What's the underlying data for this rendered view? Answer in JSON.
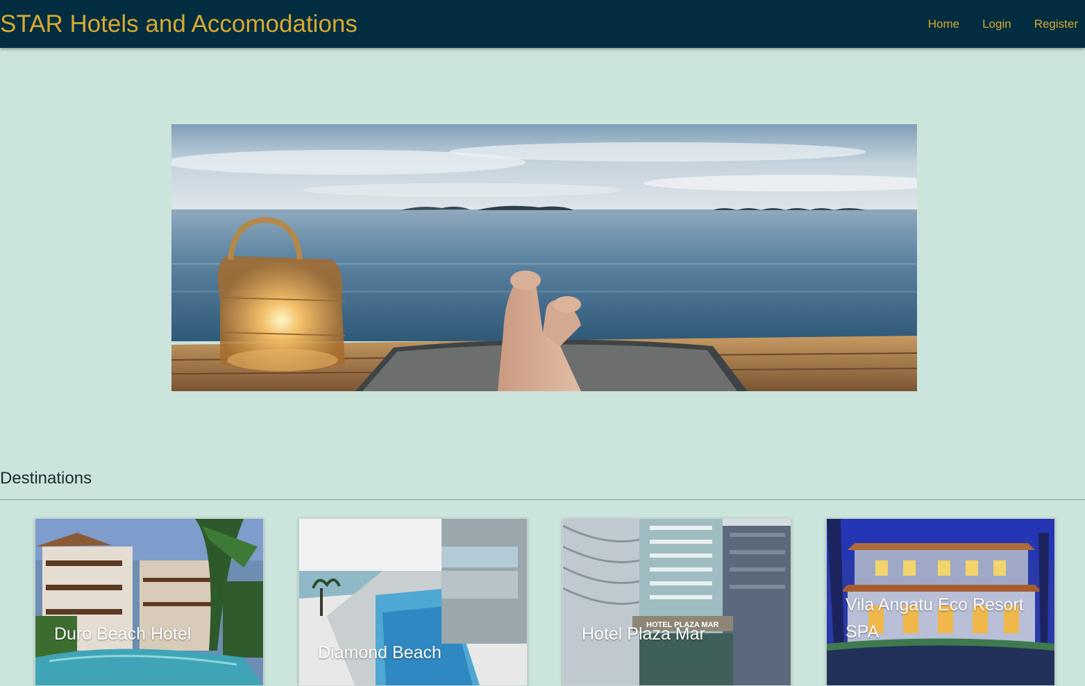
{
  "navbar": {
    "brand": "STAR Hotels and Accomodations",
    "links": [
      {
        "label": "Home"
      },
      {
        "label": "Login"
      },
      {
        "label": "Register"
      }
    ]
  },
  "hero": {
    "image": "hero-relaxation-ocean-lantern"
  },
  "destinations": {
    "title": "Destinations",
    "cards": [
      {
        "name": "Duro Beach Hotel",
        "image": "resort-with-pool-and-palms"
      },
      {
        "name": "Diamond Beach",
        "image": "infinity-pool-ocean-view"
      },
      {
        "name": "Hotel Plaza Mar",
        "image": "high-rise-hotel-building",
        "sign": "HOTEL PLAZA MAR"
      },
      {
        "name": "Vila Angatu Eco Resort SPA",
        "image": "colonial-villa-at-dusk"
      }
    ]
  },
  "colors": {
    "navbar_bg": "#022d40",
    "accent": "#d9a930",
    "page_bg": "#cbe4dc"
  }
}
